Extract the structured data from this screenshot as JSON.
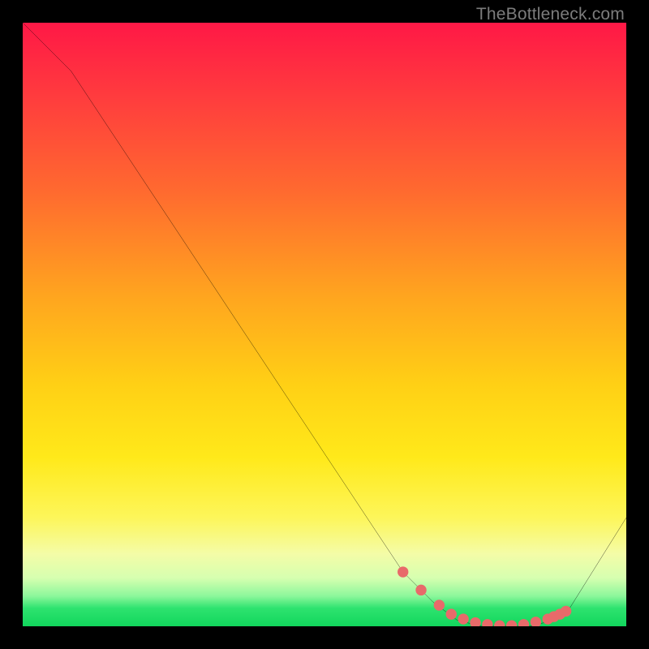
{
  "attribution": "TheBottleneck.com",
  "chart_data": {
    "type": "line",
    "title": "",
    "xlabel": "",
    "ylabel": "",
    "xlim": [
      0,
      100
    ],
    "ylim": [
      0,
      100
    ],
    "series": [
      {
        "name": "bottleneck-curve",
        "x": [
          0,
          8,
          63,
          68,
          72,
          76,
          80,
          84,
          88,
          90,
          100
        ],
        "y": [
          100,
          92,
          9,
          4,
          1,
          0,
          0,
          0,
          1,
          2,
          18
        ]
      }
    ],
    "highlight": {
      "name": "optimal-range-dots",
      "x": [
        63,
        66,
        69,
        71,
        73,
        75,
        77,
        79,
        81,
        83,
        85,
        87,
        88,
        89,
        90
      ],
      "y": [
        9,
        6,
        3.5,
        2,
        1.2,
        0.6,
        0.3,
        0.1,
        0.1,
        0.3,
        0.7,
        1.2,
        1.6,
        2.0,
        2.5
      ]
    },
    "background_gradient": {
      "stops": [
        {
          "pos": 0.0,
          "color": "#ff1846"
        },
        {
          "pos": 0.12,
          "color": "#ff3b3e"
        },
        {
          "pos": 0.28,
          "color": "#ff6a2f"
        },
        {
          "pos": 0.45,
          "color": "#ffa41f"
        },
        {
          "pos": 0.6,
          "color": "#ffd015"
        },
        {
          "pos": 0.72,
          "color": "#ffe91a"
        },
        {
          "pos": 0.82,
          "color": "#fdf65a"
        },
        {
          "pos": 0.88,
          "color": "#f4fca7"
        },
        {
          "pos": 0.92,
          "color": "#d6ffb0"
        },
        {
          "pos": 0.95,
          "color": "#8cf79b"
        },
        {
          "pos": 0.97,
          "color": "#2ee36f"
        },
        {
          "pos": 1.0,
          "color": "#11d65c"
        }
      ]
    },
    "colors": {
      "curve": "#000000",
      "highlight_dot": "#e86a6a",
      "frame": "#000000"
    }
  }
}
